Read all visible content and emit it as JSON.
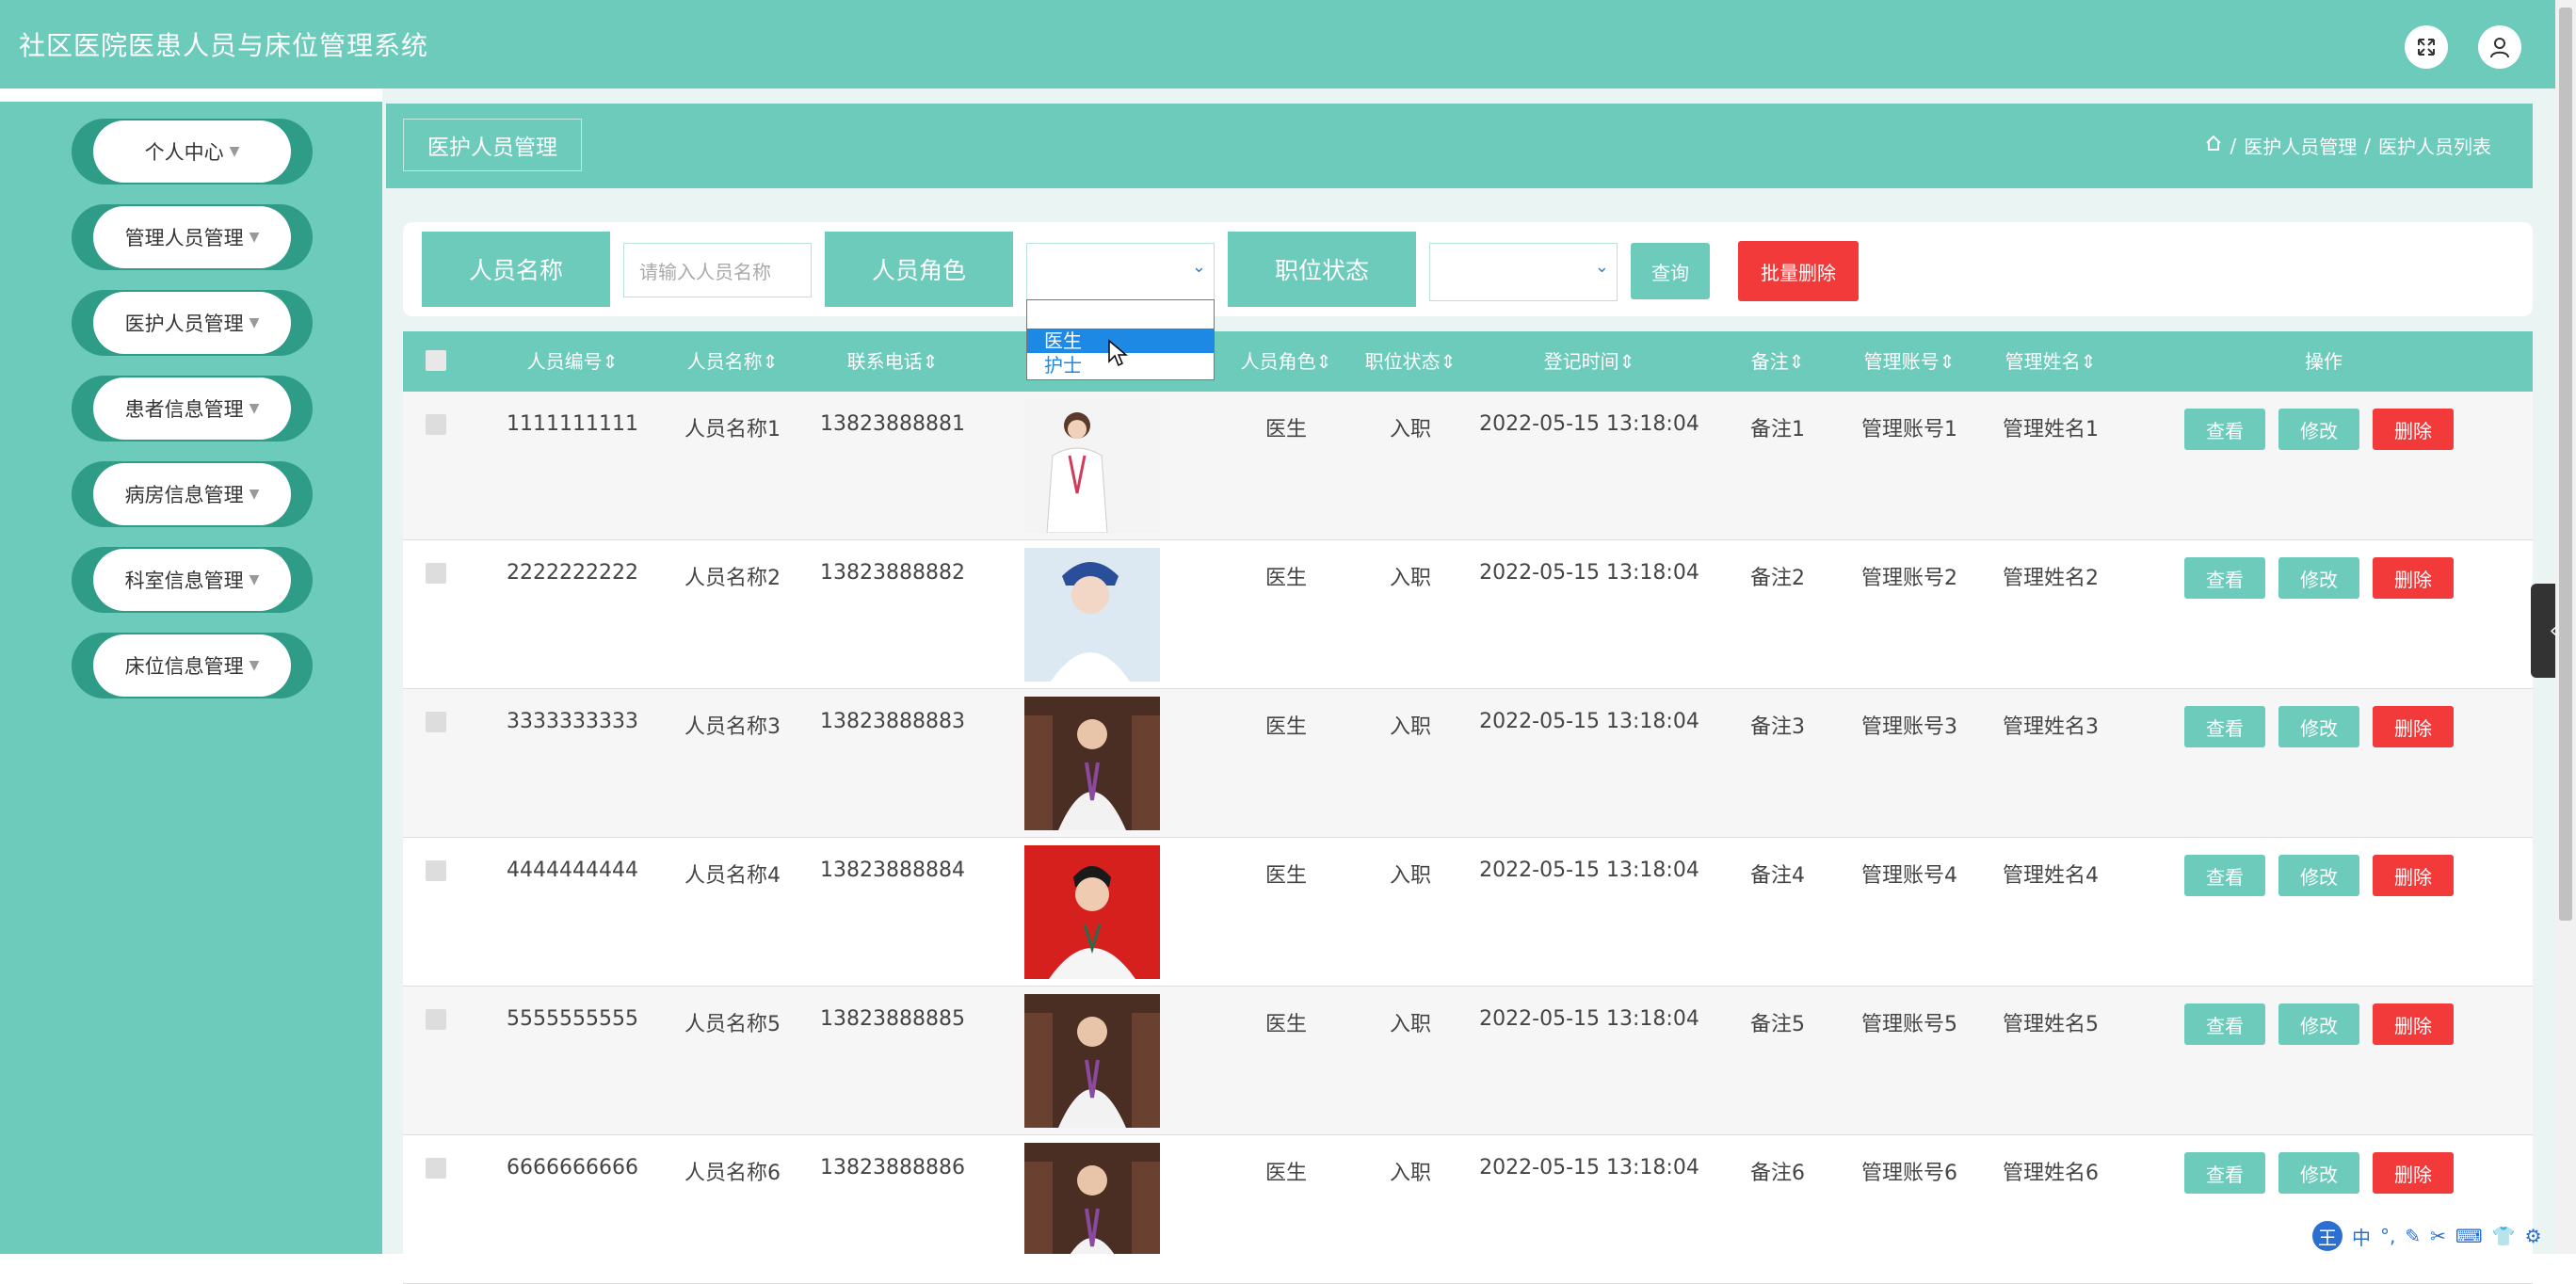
{
  "app_title": "社区医院医患人员与床位管理系统",
  "top_icons": [
    "fullscreen-icon",
    "user-icon"
  ],
  "sidebar": {
    "items": [
      {
        "label": "个人中心"
      },
      {
        "label": "管理人员管理"
      },
      {
        "label": "医护人员管理"
      },
      {
        "label": "患者信息管理"
      },
      {
        "label": "病房信息管理"
      },
      {
        "label": "科室信息管理"
      },
      {
        "label": "床位信息管理"
      }
    ]
  },
  "crumb_tab": "医护人员管理",
  "breadcrumb": {
    "level1": "医护人员管理",
    "level2": "医护人员列表",
    "sep": "/"
  },
  "search": {
    "name_label": "人员名称",
    "name_placeholder": "请输入人员名称",
    "role_label": "人员角色",
    "status_label": "职位状态",
    "query_btn": "查询",
    "batch_delete_btn": "批量删除",
    "role_options": [
      "",
      "医生",
      "护士"
    ],
    "role_highlighted": "医生"
  },
  "table": {
    "headers": {
      "id": "人员编号",
      "name": "人员名称",
      "phone": "联系电话",
      "role": "人员角色",
      "status": "职位状态",
      "time": "登记时间",
      "remark": "备注",
      "account": "管理账号",
      "manager": "管理姓名",
      "ops": "操作"
    },
    "rows": [
      {
        "id": "1111111111",
        "name": "人员名称1",
        "phone": "13823888881",
        "role": "医生",
        "status": "入职",
        "time": "2022-05-15 13:18:04",
        "remark": "备注1",
        "account": "管理账号1",
        "manager": "管理姓名1"
      },
      {
        "id": "2222222222",
        "name": "人员名称2",
        "phone": "13823888882",
        "role": "医生",
        "status": "入职",
        "time": "2022-05-15 13:18:04",
        "remark": "备注2",
        "account": "管理账号2",
        "manager": "管理姓名2"
      },
      {
        "id": "3333333333",
        "name": "人员名称3",
        "phone": "13823888883",
        "role": "医生",
        "status": "入职",
        "time": "2022-05-15 13:18:04",
        "remark": "备注3",
        "account": "管理账号3",
        "manager": "管理姓名3"
      },
      {
        "id": "4444444444",
        "name": "人员名称4",
        "phone": "13823888884",
        "role": "医生",
        "status": "入职",
        "time": "2022-05-15 13:18:04",
        "remark": "备注4",
        "account": "管理账号4",
        "manager": "管理姓名4"
      },
      {
        "id": "5555555555",
        "name": "人员名称5",
        "phone": "13823888885",
        "role": "医生",
        "status": "入职",
        "time": "2022-05-15 13:18:04",
        "remark": "备注5",
        "account": "管理账号5",
        "manager": "管理姓名5"
      },
      {
        "id": "6666666666",
        "name": "人员名称6",
        "phone": "13823888886",
        "role": "医生",
        "status": "入职",
        "time": "2022-05-15 13:18:04",
        "remark": "备注6",
        "account": "管理账号6",
        "manager": "管理姓名6"
      }
    ],
    "row_buttons": {
      "view": "查看",
      "edit": "修改",
      "delete": "删除"
    }
  },
  "ime_bar": {
    "main": "王",
    "lang": "中"
  },
  "colors": {
    "accent": "#6ccbbb",
    "accent_dark": "#2e9c86",
    "danger": "#f23a3a",
    "highlight": "#1e88e5"
  }
}
